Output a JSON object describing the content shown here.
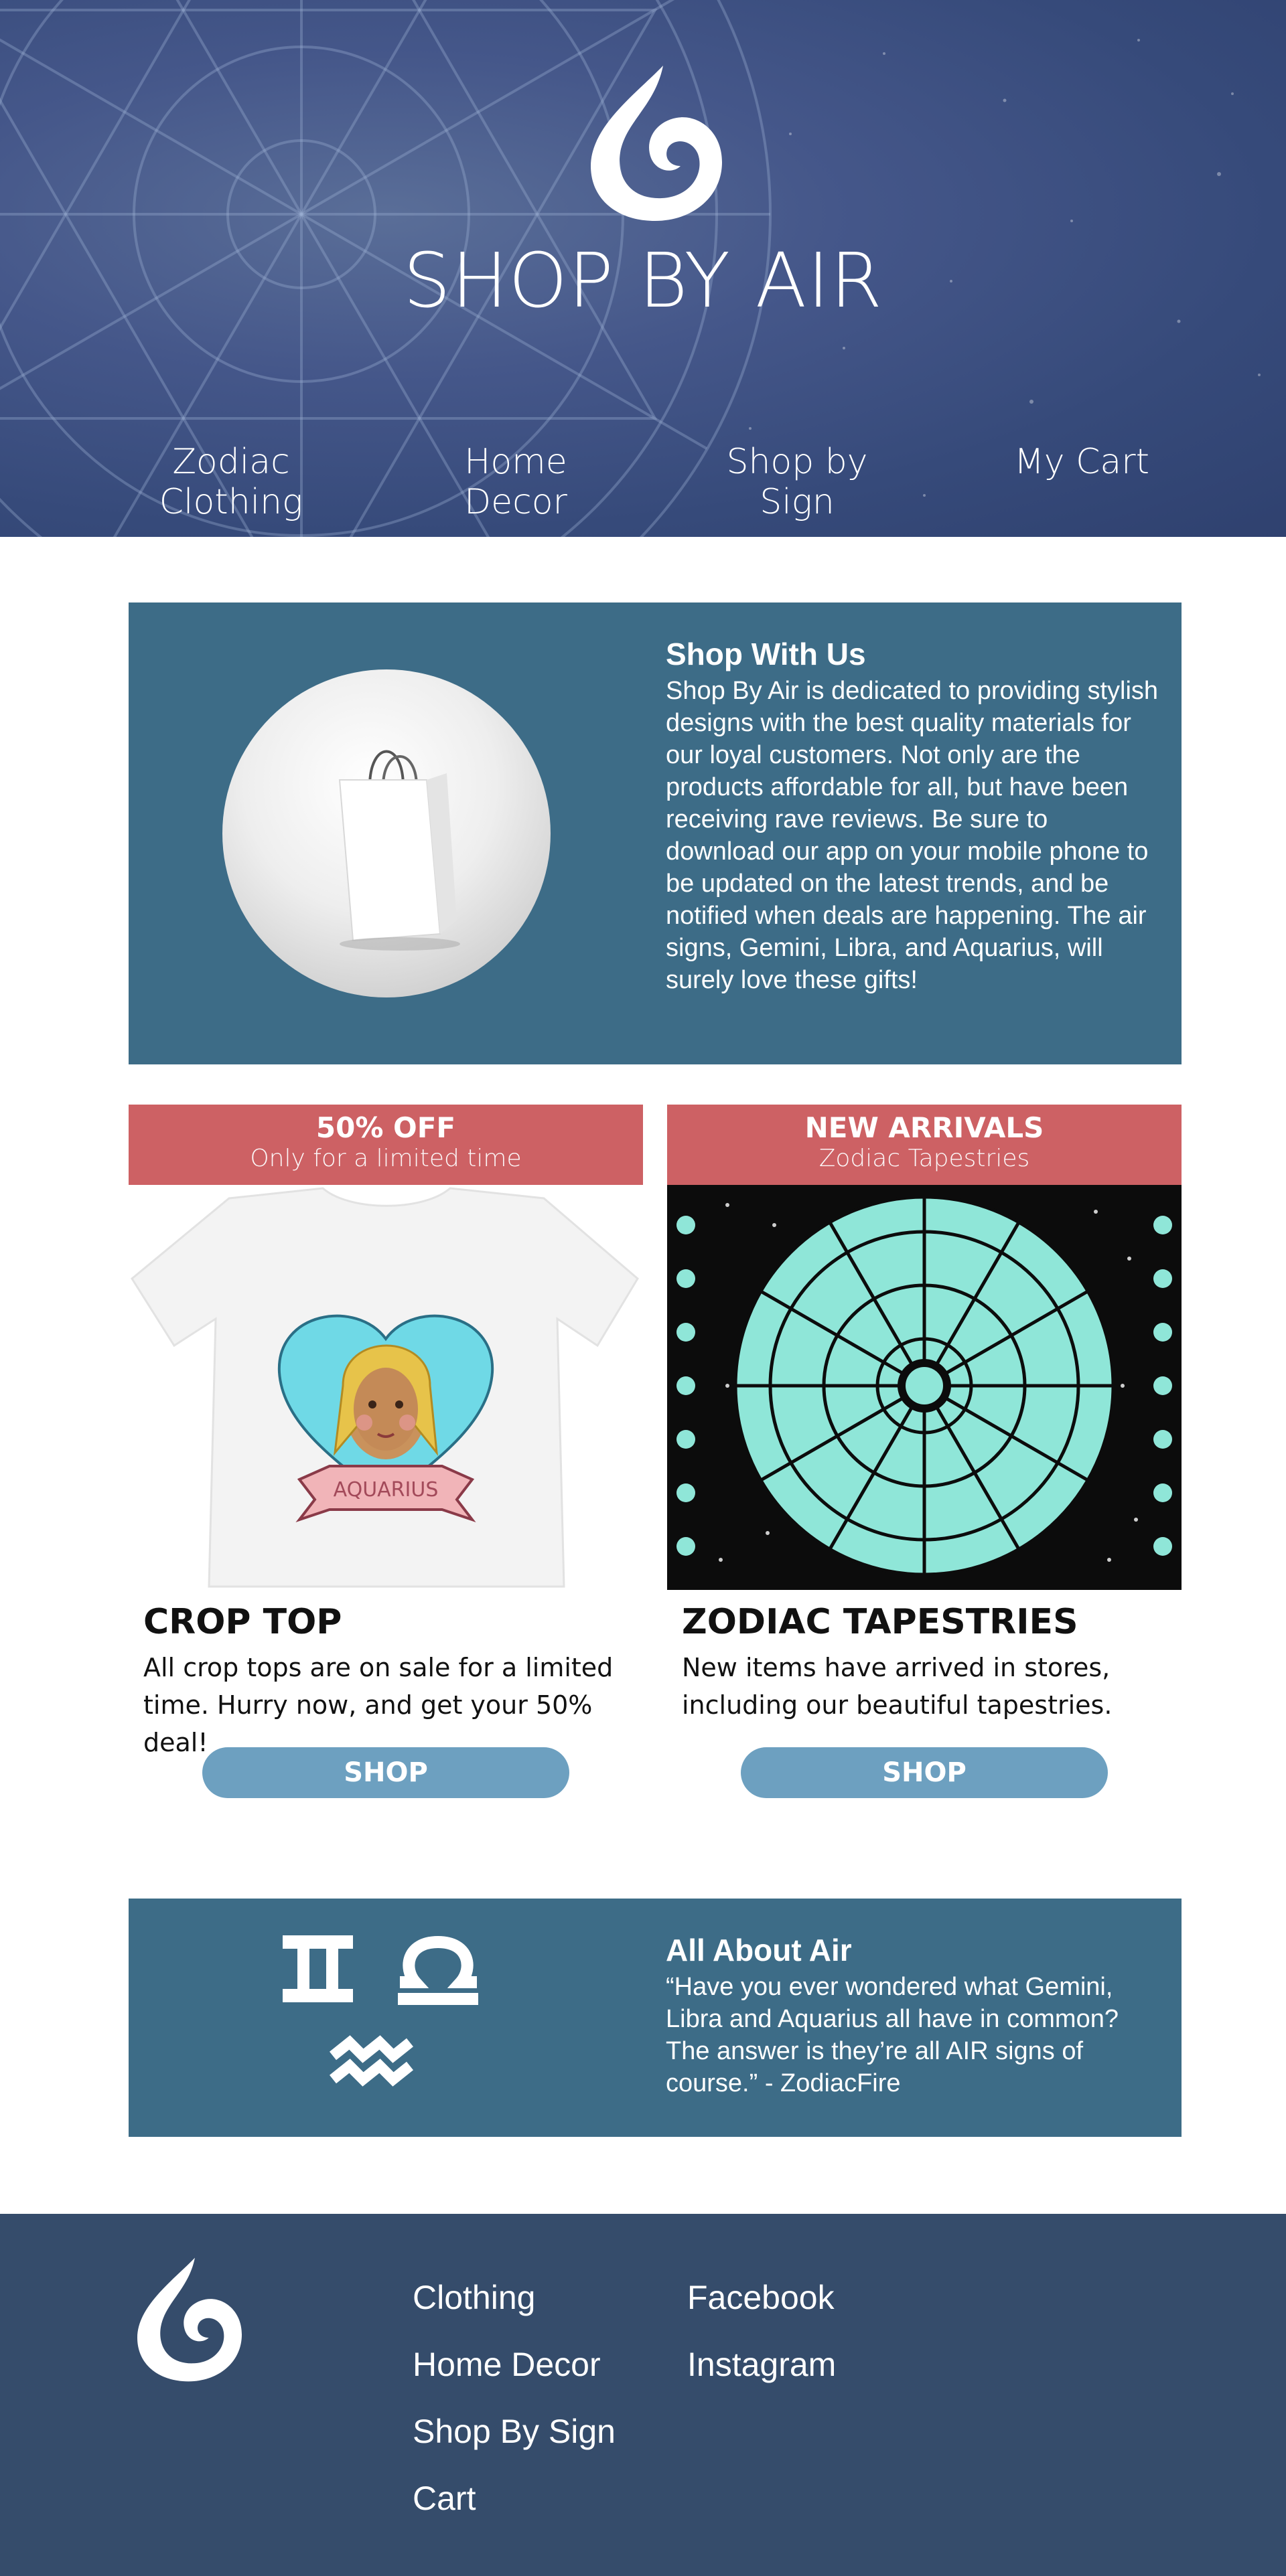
{
  "brand": {
    "name": "SHOP BY AIR"
  },
  "nav": {
    "items": [
      {
        "label": "Zodiac Clothing",
        "active": true
      },
      {
        "label": "Home Decor",
        "active": false
      },
      {
        "label": "Shop by Sign",
        "active": false
      },
      {
        "label": "My Cart",
        "active": false
      }
    ]
  },
  "about": {
    "title": "Shop With Us",
    "body": "Shop By Air is dedicated to providing stylish designs with the best quality materials for our loyal customers. Not only are the products affordable for all, but have been receiving rave reviews. Be sure to download our app on your mobile phone to be updated on the latest trends, and be notified when deals are happening. The air signs, Gemini, Libra, and Aquarius, will surely love these gifts!"
  },
  "promos": [
    {
      "banner_title": "50% OFF",
      "banner_sub": "Only for a limited time",
      "shirt_text": "AQUARIUS",
      "heading": "CROP TOP",
      "text": "All crop tops are on sale for a limited time. Hurry now, and get your 50% deal!",
      "button": "SHOP"
    },
    {
      "banner_title": "NEW ARRIVALS",
      "banner_sub": "Zodiac Tapestries",
      "heading": "ZODIAC TAPESTRIES",
      "text": "New items have arrived in stores, including our beautiful tapestries.",
      "button": "SHOP"
    }
  ],
  "air": {
    "title": "All About Air",
    "body": "“Have you ever wondered what Gemini, Libra and Aquarius all have in common? The answer is they’re all AIR signs of course.” - ZodiacFire"
  },
  "footer": {
    "col1": [
      "Clothing",
      "Home Decor",
      "Shop By Sign",
      "Cart"
    ],
    "col2": [
      "Facebook",
      "Instagram"
    ]
  },
  "colors": {
    "header_bg": "#3f5284",
    "panel_bg": "#3d6c87",
    "banner_red": "#cd6164",
    "button_blue": "#6da0c0",
    "nav_underline": "#8fb7a7",
    "footer_bg": "#354c6b"
  }
}
